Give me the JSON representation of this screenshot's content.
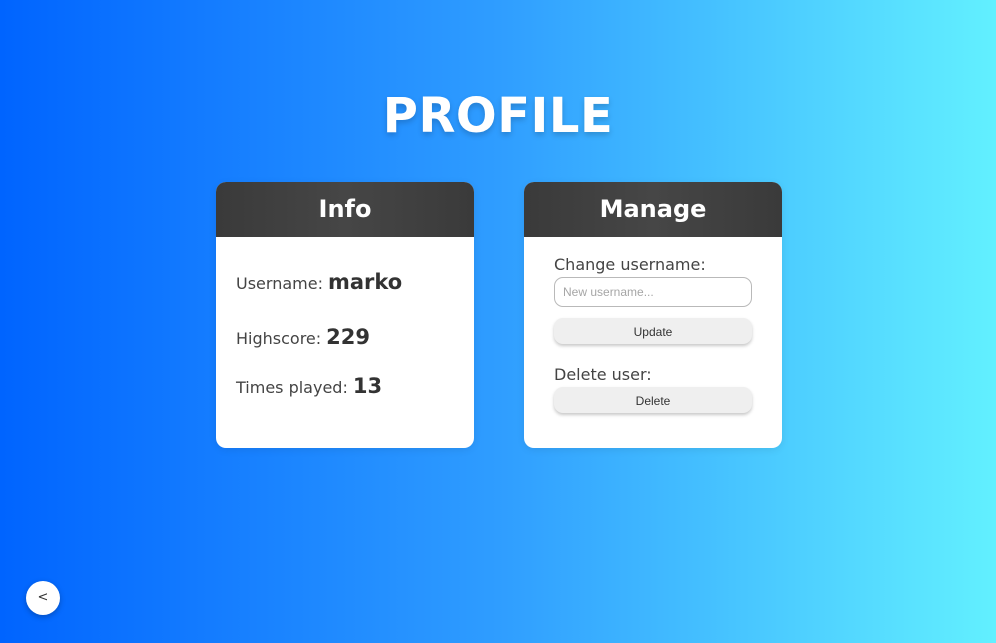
{
  "page": {
    "title": "PROFILE"
  },
  "info_card": {
    "header": "Info",
    "username_label": "Username:",
    "username_value": "marko",
    "highscore_label": "Highscore:",
    "highscore_value": "229",
    "times_played_label": "Times played:",
    "times_played_value": "13"
  },
  "manage_card": {
    "header": "Manage",
    "change_username_label": "Change username:",
    "username_input": {
      "value": "",
      "placeholder": "New username..."
    },
    "update_button": "Update",
    "delete_user_label": "Delete user:",
    "delete_button": "Delete"
  },
  "back_button": {
    "label": "<"
  },
  "colors": {
    "background_gradient_start": "#0064ff",
    "background_gradient_end": "#62f0ff",
    "card_header": "#3f3f3f",
    "card_body": "#ffffff",
    "button": "#efefef"
  }
}
